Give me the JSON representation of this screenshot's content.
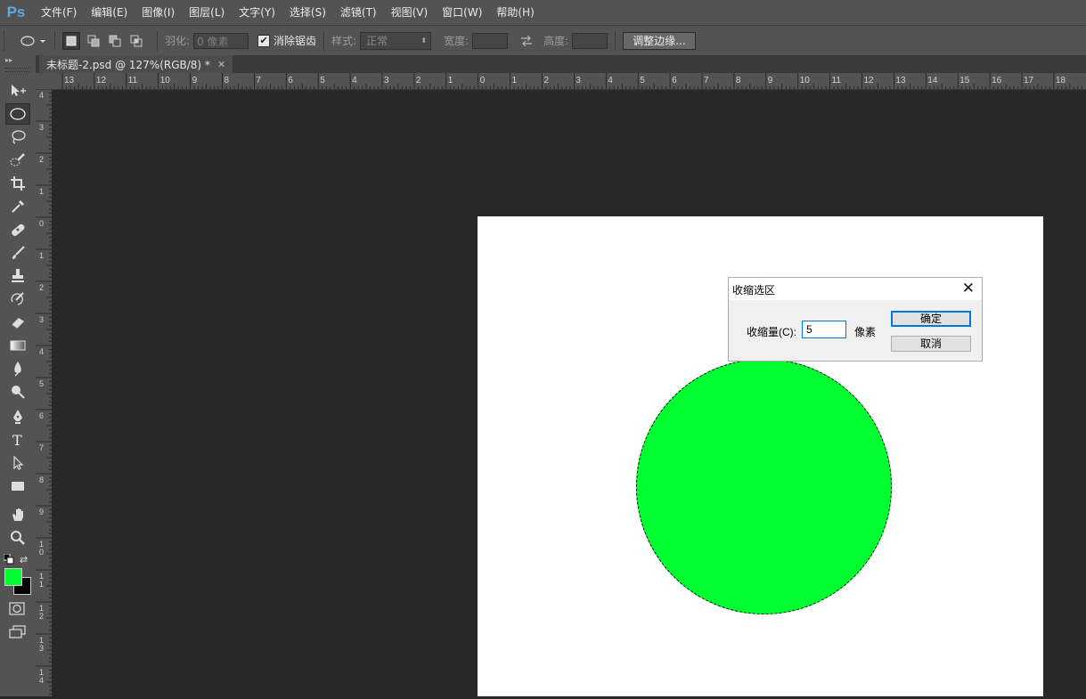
{
  "app": {
    "logo": "Ps"
  },
  "menu": [
    "文件(F)",
    "编辑(E)",
    "图像(I)",
    "图层(L)",
    "文字(Y)",
    "选择(S)",
    "滤镜(T)",
    "视图(V)",
    "窗口(W)",
    "帮助(H)"
  ],
  "options": {
    "feather_label": "羽化:",
    "feather_placeholder": "0 像素",
    "antialias_label": "消除锯齿",
    "antialias_checked": true,
    "style_label": "样式:",
    "style_value": "正常",
    "width_label": "宽度:",
    "height_label": "高度:",
    "refine_edge_label": "调整边缘..."
  },
  "document": {
    "tab_title": "未标题-2.psd @ 127%(RGB/8) *",
    "shape_color": "#00ff31",
    "background": "#ffffff"
  },
  "rulers": {
    "h_labels": [
      "13",
      "12",
      "11",
      "10",
      "9",
      "8",
      "7",
      "6",
      "5",
      "4",
      "3",
      "2",
      "1",
      "0",
      "1",
      "2",
      "3",
      "4",
      "5",
      "6",
      "7",
      "8",
      "9",
      "10",
      "11",
      "12",
      "13",
      "14",
      "15",
      "16",
      "17",
      "18"
    ],
    "v_labels": [
      "4",
      "3",
      "2",
      "1",
      "0",
      "1",
      "2",
      "3",
      "4",
      "5",
      "6",
      "7",
      "8",
      "9",
      "10",
      "11",
      "12",
      "13",
      "14"
    ]
  },
  "tools": [
    {
      "name": "move-tool"
    },
    {
      "name": "elliptical-marquee-tool",
      "active": true
    },
    {
      "name": "lasso-tool"
    },
    {
      "name": "quick-selection-tool"
    },
    {
      "name": "crop-tool"
    },
    {
      "name": "eyedropper-tool"
    },
    {
      "name": "healing-brush-tool"
    },
    {
      "name": "brush-tool"
    },
    {
      "name": "clone-stamp-tool"
    },
    {
      "name": "history-brush-tool"
    },
    {
      "name": "eraser-tool"
    },
    {
      "name": "gradient-tool"
    },
    {
      "name": "blur-tool"
    },
    {
      "name": "dodge-tool"
    },
    {
      "name": "pen-tool"
    },
    {
      "name": "type-tool"
    },
    {
      "name": "path-selection-tool"
    },
    {
      "name": "rectangle-tool"
    },
    {
      "name": "hand-tool"
    },
    {
      "name": "zoom-tool"
    }
  ],
  "colors": {
    "foreground": "#00ff31",
    "background": "#000000"
  },
  "dialog": {
    "title": "收缩选区",
    "amount_label": "收缩量(C):",
    "amount_value": "5",
    "unit": "像素",
    "ok": "确定",
    "cancel": "取消"
  }
}
